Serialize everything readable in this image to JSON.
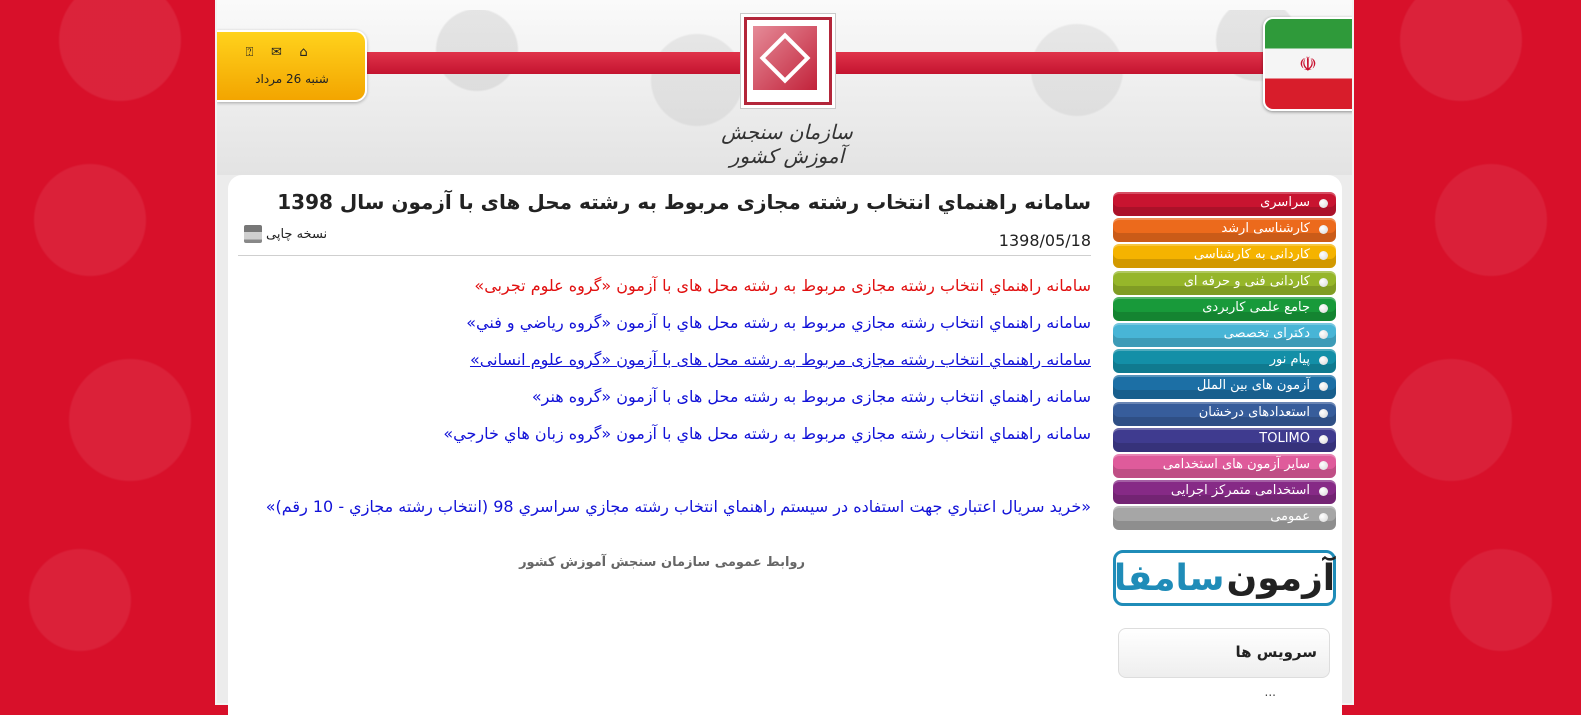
{
  "header": {
    "date": "شنبه 26 مرداد",
    "icons": [
      "help-icon",
      "mail-icon",
      "home-icon"
    ],
    "logo_text": "سازمان سنجش آموزش کشور"
  },
  "article": {
    "title": "سامانه راهنماي انتخاب رشته مجازی مربوط به رشته محل های با آزمون سال 1398",
    "date": "1398/05/18",
    "print_label": "نسخه چاپی",
    "links": [
      "سامانه راهنماي انتخاب رشته مجازی مربوط به رشته محل های با آزمون «گروه علوم تجربی»",
      "سامانه راهنماي انتخاب رشته مجازي مربوط به رشته محل هاي با آزمون «گروه رياضي و فني»",
      "سامانه راهنماي انتخاب رشته مجازی  مربوط به رشته محل های با آزمون «گروه علوم انسانی»",
      "سامانه راهنماي انتخاب رشته مجازی مربوط به رشته محل های با آزمون «گروه هنر»",
      "سامانه راهنماي انتخاب رشته مجازي مربوط به رشته محل هاي با آزمون «گروه زبان هاي خارجي»",
      "«خريد سريال اعتباري جهت استفاده در سيستم راهنماي انتخاب رشته مجازي سراسري 98 (انتخاب رشته مجازي - 10 رقم)»"
    ],
    "footer": "روابط عمومی سازمان سنجش آموزش کشور"
  },
  "sidebar": {
    "menu": [
      {
        "label": "سراسری",
        "color": "#c81430"
      },
      {
        "label": "کارشناسی ارشد",
        "color": "#ec6a1c"
      },
      {
        "label": "کاردانی به کارشناسی",
        "color": "#f5b300"
      },
      {
        "label": "کاردانی فنی و حرفه ای",
        "color": "#96b62a"
      },
      {
        "label": "جامع علمی کاربردی",
        "color": "#189a3a"
      },
      {
        "label": "دکترای تخصصی",
        "color": "#48b5d6"
      },
      {
        "label": "پیام نور",
        "color": "#138fa7"
      },
      {
        "label": "آزمون های بین الملل",
        "color": "#1c6fa5"
      },
      {
        "label": "استعدادهای درخشان",
        "color": "#375d9b"
      },
      {
        "label": "TOLIMO",
        "color": "#3f3b8f"
      },
      {
        "label": "سایر آزمون های استخدامی",
        "color": "#df5b9b"
      },
      {
        "label": "استخدامی متمرکز اجرایی",
        "color": "#862a86"
      },
      {
        "label": "عمومی",
        "color": "#a6a6a6"
      }
    ],
    "samfa_a": "آزمون",
    "samfa_b": "سامفا",
    "services_title": "سرویس ها",
    "services_next": "..."
  }
}
